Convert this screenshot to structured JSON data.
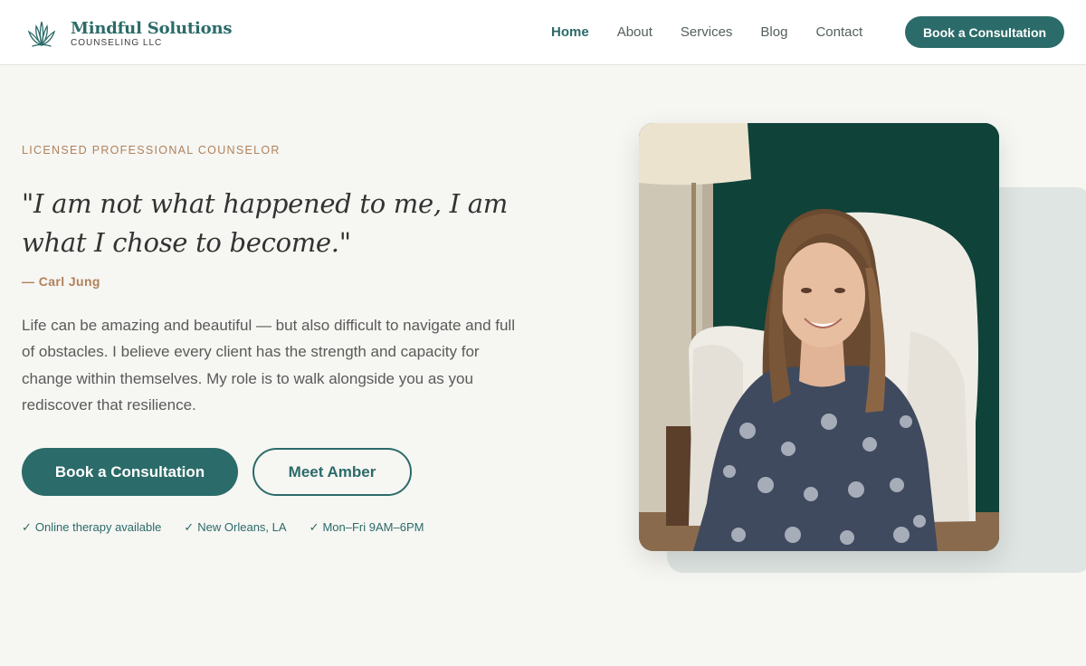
{
  "brand": {
    "name": "Mindful Solutions",
    "subtitle": "COUNSELING LLC",
    "logo_icon": "lotus-icon"
  },
  "nav": {
    "items": [
      {
        "label": "Home",
        "active": true
      },
      {
        "label": "About",
        "active": false
      },
      {
        "label": "Services",
        "active": false
      },
      {
        "label": "Blog",
        "active": false
      },
      {
        "label": "Contact",
        "active": false
      }
    ],
    "cta_label": "Book a Consultation"
  },
  "hero": {
    "eyebrow": "LICENSED PROFESSIONAL COUNSELOR",
    "quote": "\"I am not what happened to me, I am what I chose to become.\"",
    "attribution": "— Carl Jung",
    "body": "Life can be amazing and beautiful — but also difficult to navigate and full of obstacles. I believe every client has the strength and capacity for change within themselves. My role is to walk alongside you as you rediscover that resilience.",
    "primary_button": "Book a Consultation",
    "secondary_button": "Meet Amber",
    "features": [
      {
        "check": "✓",
        "label": "Online therapy available"
      },
      {
        "check": "✓",
        "label": "New Orleans, LA"
      },
      {
        "check": "✓",
        "label": "Mon–Fri 9AM–6PM"
      }
    ]
  },
  "colors": {
    "brand": "#2b6b69",
    "accent": "#b0825a",
    "background": "#f6f6f3",
    "photo_backdrop": "#dfe5e2"
  }
}
